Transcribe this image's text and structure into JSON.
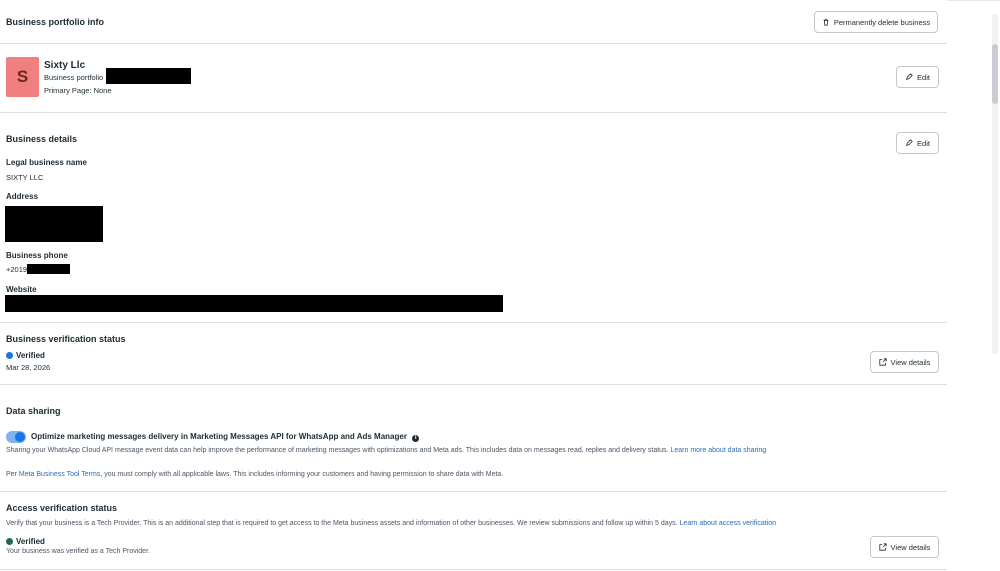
{
  "portfolio_info": {
    "title": "Business portfolio info",
    "delete_button": "Permanently delete business",
    "avatar_letter": "S",
    "avatar_color": "#f08080",
    "business_name": "Sixty Llc",
    "portfolio_label": "Business portfolio",
    "primary_page": "Primary Page: None",
    "edit_button": "Edit"
  },
  "business_details": {
    "title": "Business details",
    "edit_button": "Edit",
    "legal_name_label": "Legal business name",
    "legal_name_value": "SIXTY LLC",
    "address_label": "Address",
    "phone_label": "Business phone",
    "phone_prefix": "+2019",
    "website_label": "Website"
  },
  "verification": {
    "title": "Business verification status",
    "status": "Verified",
    "status_color": "#1b74e4",
    "date": "Mar 28, 2026",
    "view_details_button": "View details"
  },
  "data_sharing": {
    "title": "Data sharing",
    "toggle_on": true,
    "toggle_label": "Optimize marketing messages delivery in Marketing Messages API for WhatsApp and Ads Manager",
    "description": "Sharing your WhatsApp Cloud API message event data can help improve the performance of marketing messages with optimizations and Meta ads. This includes data on messages read, replies and delivery status.",
    "learn_more_link": "Learn more about data sharing",
    "terms_prefix": "Per",
    "terms_link": "Meta Business Tool Terms",
    "terms_suffix": ", you must comply with all applicable laws. This includes informing your customers and having permission to share data with Meta."
  },
  "access_verification": {
    "title": "Access verification status",
    "description": "Verify that your business is a Tech Provider. This is an additional step that is required to get access to the Meta business assets and information of other businesses. We review submissions and follow up within 5 days.",
    "learn_more_link": "Learn about access verification",
    "status": "Verified",
    "status_color": "#1d6b45",
    "status_detail": "Your business was verified as a Tech Provider.",
    "view_details_button": "View details"
  },
  "icons": {
    "delete": "trash-icon",
    "edit": "pencil-icon",
    "external": "external-link-icon",
    "info": "info-icon",
    "verified": "verified-dot-icon"
  }
}
